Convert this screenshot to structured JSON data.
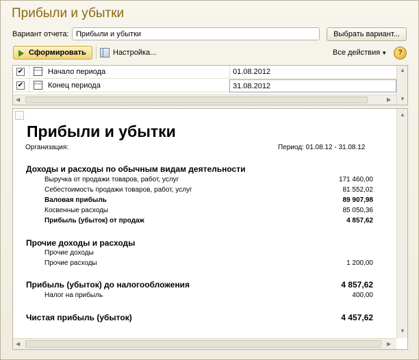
{
  "window": {
    "title": "Прибыли и убытки"
  },
  "variant": {
    "label": "Вариант отчета:",
    "value": "Прибыли и убытки",
    "choose_button": "Выбрать вариант..."
  },
  "toolbar": {
    "form_button": "Сформировать",
    "settings": "Настройка...",
    "all_actions": "Все действия",
    "help": "?"
  },
  "params": [
    {
      "name": "Начало периода",
      "value": "01.08.2012",
      "checked": true
    },
    {
      "name": "Конец периода",
      "value": "31.08.2012",
      "checked": true
    }
  ],
  "report": {
    "title": "Прибыли и убытки",
    "org_label": "Организация:",
    "period": "Период: 01.08.12 - 31.08.12",
    "section1": {
      "heading": "Доходы и расходы по обычным видам деятельности",
      "lines": [
        {
          "label": "Выручка от продажи товаров, работ, услуг",
          "amount": "171 460,00",
          "bold": false
        },
        {
          "label": "Себестоимость продажи товаров, работ, услуг",
          "amount": "81 552,02",
          "bold": false
        },
        {
          "label": "Валовая прибыль",
          "amount": "89 907,98",
          "bold": true
        },
        {
          "label": "Косвенные расходы",
          "amount": "85 050,36",
          "bold": false
        },
        {
          "label": "Прибыль (убыток) от продаж",
          "amount": "4 857,62",
          "bold": true
        }
      ]
    },
    "section2": {
      "heading": "Прочие доходы и расходы",
      "lines": [
        {
          "label": "Прочие доходы",
          "amount": ""
        },
        {
          "label": "Прочие расходы",
          "amount": "1 200,00"
        }
      ]
    },
    "pretax": {
      "label": "Прибыль (убыток) до налогообложения",
      "amount": "4 857,62"
    },
    "tax": {
      "label": "Налог на прибыль",
      "amount": "400,00"
    },
    "net": {
      "label": "Чистая прибыль (убыток)",
      "amount": "4 457,62"
    }
  },
  "icons": [
    "play-icon",
    "settings-icon",
    "calendar-icon",
    "help-icon",
    "checkbox-icon"
  ]
}
